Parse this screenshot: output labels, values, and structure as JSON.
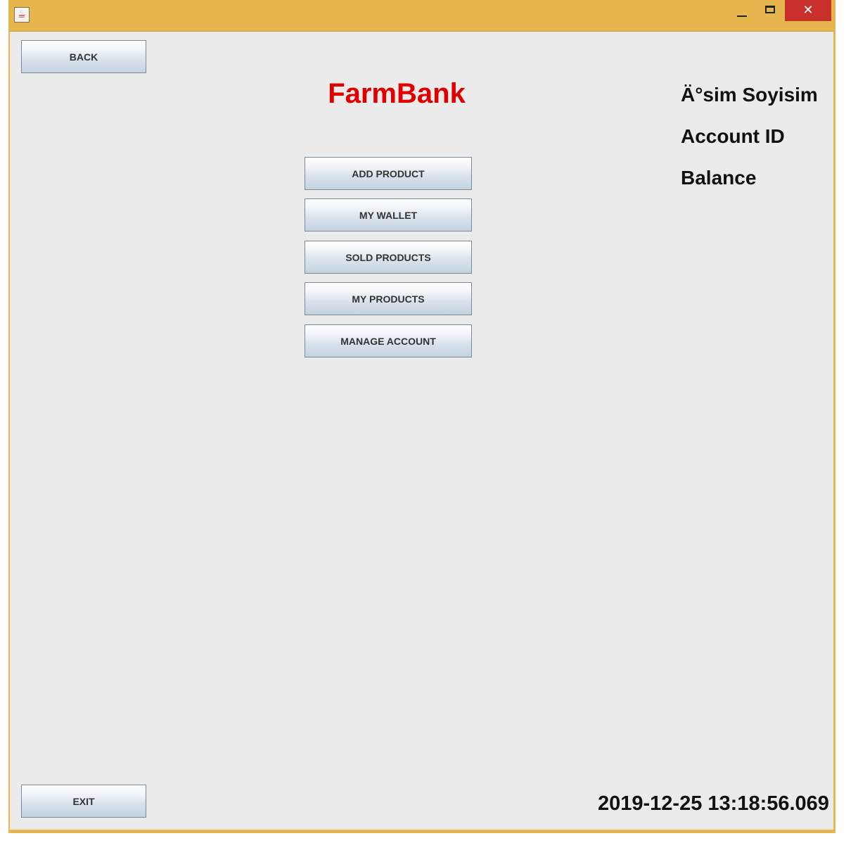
{
  "window": {
    "icon": "java-cup-icon",
    "controls": {
      "minimize": "minimize-icon",
      "maximize": "maximize-icon",
      "close": "✕"
    },
    "accent_color": "#e8b64f"
  },
  "nav": {
    "back_label": "BACK",
    "exit_label": "EXIT"
  },
  "app": {
    "title": "FarmBank",
    "title_color": "#e00000"
  },
  "menu": {
    "buttons": [
      {
        "label": "ADD PRODUCT"
      },
      {
        "label": "MY WALLET"
      },
      {
        "label": "SOLD PRODUCTS"
      },
      {
        "label": "MY PRODUCTS"
      },
      {
        "label": "MANAGE ACCOUNT"
      }
    ]
  },
  "account": {
    "name": "Ä°sim Soyisim",
    "account_id": "Account ID",
    "balance": "Balance"
  },
  "status": {
    "timestamp": "2019-12-25 13:18:56.069"
  }
}
